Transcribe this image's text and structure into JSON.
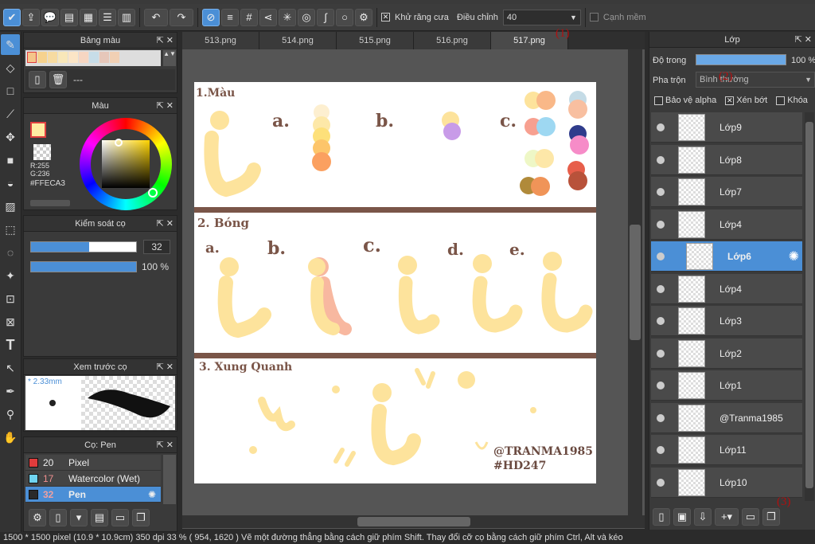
{
  "toolbar": {
    "antialias_label": "Khử răng cưa",
    "adjust_label": "Điều chỉnh",
    "adjust_value": "40",
    "soft_edge_label": "Cạnh mềm"
  },
  "palette_panel": {
    "title": "Bảng màu",
    "swatches": [
      "#f5c58a",
      "#f6d28e",
      "#f7dba1",
      "#f8e7b9",
      "#fbe5c6",
      "#f6d6c2",
      "#c7dde8",
      "#e6c7ba",
      "#f1d0b4"
    ],
    "input": "---"
  },
  "color_panel": {
    "title": "Màu",
    "r": "R:255",
    "g": "G:236",
    "hex": "#FFECA3"
  },
  "brush_control": {
    "title": "Kiểm soát cọ",
    "size": "32",
    "opacity_label": "100 %",
    "size_fraction": 0.55,
    "opacity_fraction": 1.0
  },
  "brush_preview": {
    "title": "Xem trước cọ",
    "size_label": "2.33mm"
  },
  "brush_list": {
    "title": "Cọ: Pen",
    "items": [
      {
        "size": "20",
        "name": "Pixel",
        "color": "#e03c3c"
      },
      {
        "size": "17",
        "name": "Watercolor (Wet)",
        "color": "#6fd3f0"
      },
      {
        "size": "32",
        "name": "Pen",
        "color": "#2a2a2a"
      }
    ]
  },
  "tabs": [
    "513.png",
    "514.png",
    "515.png",
    "516.png",
    "517.png"
  ],
  "annotations": {
    "a1": "(1)",
    "a2": "(2)",
    "a3": "(3)"
  },
  "artwork": {
    "s1": "1.Màu",
    "s2": "2. Bóng",
    "s3": "3. Xung Quanh",
    "la": "a.",
    "lb": "b.",
    "lc": "c.",
    "ld": "d.",
    "le": "e.",
    "credit1": "@TRANMA1985",
    "credit2": "#HD247"
  },
  "layer_panel": {
    "title": "Lớp",
    "opacity_label": "Độ trong",
    "opacity_value": "100 %",
    "opacity_fraction": 1.0,
    "blend_label": "Pha trộn",
    "blend_value": "Bình thường",
    "protect_alpha": "Bảo vệ alpha",
    "clipping": "Xén bớt",
    "lock": "Khóa",
    "layers": [
      "Lớp9",
      "Lớp8",
      "Lớp7",
      "Lớp4",
      "Lớp6",
      "Lớp4",
      "Lớp3",
      "Lớp2",
      "Lớp1",
      "@Tranma1985",
      "Lớp11",
      "Lớp10"
    ]
  },
  "status": "1500 * 1500 pixel   (10.9 * 10.9cm)   350 dpi   33 %   ( 954, 1620 )   Vẽ một đường thẳng bằng cách giữ phím Shift. Thay đổi cỡ cọ bằng cách giữ phím Ctrl, Alt và kéo"
}
